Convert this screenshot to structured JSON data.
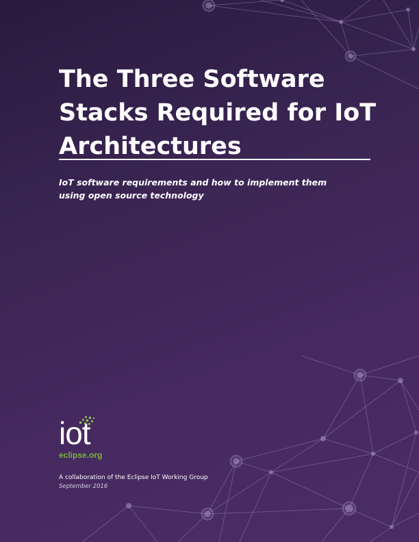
{
  "title": "The Three Software Stacks Required for IoT Architectures",
  "subtitle": {
    "line1": "IoT software requirements and how to implement them",
    "line2": "using open source technology"
  },
  "logo": {
    "word": "iot",
    "domain": "eclipse.org"
  },
  "footer": {
    "collaboration": "A collaboration of the Eclipse IoT Working Group",
    "date": "September 2016"
  },
  "colors": {
    "background": "#3a2553",
    "accent_green": "#7ab23f",
    "text": "#ffffff"
  }
}
